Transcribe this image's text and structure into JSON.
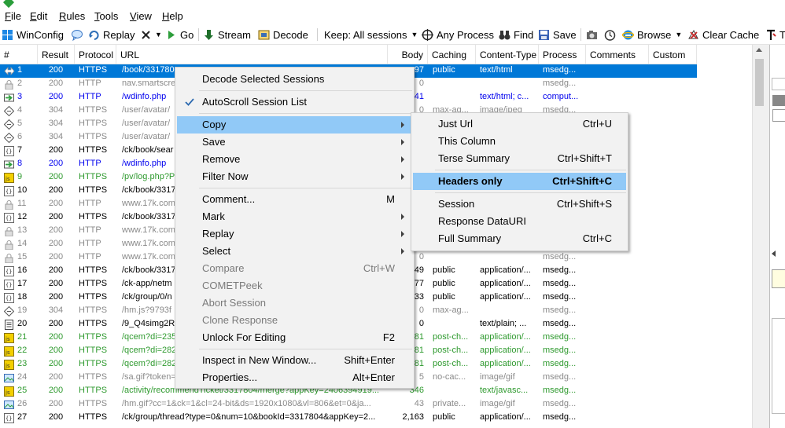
{
  "menubar": [
    "File",
    "Edit",
    "Rules",
    "Tools",
    "View",
    "Help"
  ],
  "toolbar": {
    "winconfig": "WinConfig",
    "replay": "Replay",
    "go": "Go",
    "stream": "Stream",
    "decode": "Decode",
    "keep": "Keep: All sessions",
    "any_process": "Any Process",
    "find": "Find",
    "save": "Save",
    "browse": "Browse",
    "clear_cache": "Clear Cache",
    "text_wizard": "T"
  },
  "columns": [
    "#",
    "Result",
    "Protocol",
    "URL",
    "Body",
    "Caching",
    "Content-Type",
    "Process",
    "Comments",
    "Custom"
  ],
  "rows": [
    {
      "id": "1",
      "result": "200",
      "protocol": "HTTPS",
      "url": "/book/331780",
      "body": "97",
      "caching": "public",
      "ctype": "text/html",
      "process": "msedg...",
      "style": "selected",
      "icon": "icon-arrows"
    },
    {
      "id": "2",
      "result": "200",
      "protocol": "HTTP",
      "url": "nav.smartscre",
      "body": "0",
      "caching": "",
      "ctype": "",
      "process": "msedg...",
      "style": "gray",
      "icon": "icon-lock"
    },
    {
      "id": "3",
      "result": "200",
      "protocol": "HTTP",
      "url": "/wdinfo.php",
      "body": "41",
      "caching": "",
      "ctype": "text/html; c...",
      "process": "comput...",
      "style": "blue",
      "icon": "icon-arrow-green"
    },
    {
      "id": "4",
      "result": "304",
      "protocol": "HTTPS",
      "url": "/user/avatar/",
      "body": "0",
      "caching": "max-ag...",
      "ctype": "image/jpeg",
      "process": "msedg...",
      "style": "gray",
      "icon": "icon-diamond"
    },
    {
      "id": "5",
      "result": "304",
      "protocol": "HTTPS",
      "url": "/user/avatar/",
      "body": "",
      "caching": "",
      "ctype": "",
      "process": "",
      "style": "gray",
      "icon": "icon-diamond"
    },
    {
      "id": "6",
      "result": "304",
      "protocol": "HTTPS",
      "url": "/user/avatar/",
      "body": "",
      "caching": "",
      "ctype": "",
      "process": "",
      "style": "gray",
      "icon": "icon-diamond"
    },
    {
      "id": "7",
      "result": "200",
      "protocol": "HTTPS",
      "url": "/ck/book/sear",
      "body": "",
      "caching": "",
      "ctype": "",
      "process": "",
      "style": "black",
      "icon": "icon-json"
    },
    {
      "id": "8",
      "result": "200",
      "protocol": "HTTP",
      "url": "/wdinfo.php",
      "body": "",
      "caching": "",
      "ctype": "",
      "process": "",
      "style": "blue",
      "icon": "icon-arrow-green"
    },
    {
      "id": "9",
      "result": "200",
      "protocol": "HTTPS",
      "url": "/pv/log.php?P",
      "body": "",
      "caching": "",
      "ctype": "",
      "process": "",
      "style": "green",
      "icon": "icon-js"
    },
    {
      "id": "10",
      "result": "200",
      "protocol": "HTTPS",
      "url": "/ck/book/3317",
      "body": "",
      "caching": "",
      "ctype": "",
      "process": "",
      "style": "black",
      "icon": "icon-json"
    },
    {
      "id": "11",
      "result": "200",
      "protocol": "HTTP",
      "url": "www.17k.com",
      "body": "",
      "caching": "",
      "ctype": "",
      "process": "",
      "style": "gray",
      "icon": "icon-lock"
    },
    {
      "id": "12",
      "result": "200",
      "protocol": "HTTPS",
      "url": "/ck/book/3317",
      "body": "",
      "caching": "",
      "ctype": "",
      "process": "",
      "style": "black",
      "icon": "icon-json"
    },
    {
      "id": "13",
      "result": "200",
      "protocol": "HTTP",
      "url": "www.17k.com",
      "body": "",
      "caching": "",
      "ctype": "",
      "process": "",
      "style": "gray",
      "icon": "icon-lock"
    },
    {
      "id": "14",
      "result": "200",
      "protocol": "HTTP",
      "url": "www.17k.com",
      "body": "",
      "caching": "",
      "ctype": "",
      "process": "",
      "style": "gray",
      "icon": "icon-lock"
    },
    {
      "id": "15",
      "result": "200",
      "protocol": "HTTP",
      "url": "www.17k.com",
      "body": "0",
      "caching": "",
      "ctype": "",
      "process": "msedg...",
      "style": "gray",
      "icon": "icon-lock"
    },
    {
      "id": "16",
      "result": "200",
      "protocol": "HTTPS",
      "url": "/ck/book/3317",
      "body": "49",
      "caching": "public",
      "ctype": "application/...",
      "process": "msedg...",
      "style": "black",
      "icon": "icon-json"
    },
    {
      "id": "17",
      "result": "200",
      "protocol": "HTTPS",
      "url": "/ck-app/netm",
      "body": "77",
      "caching": "public",
      "ctype": "application/...",
      "process": "msedg...",
      "style": "black",
      "icon": "icon-json"
    },
    {
      "id": "18",
      "result": "200",
      "protocol": "HTTPS",
      "url": "/ck/group/0/n",
      "body": "33",
      "caching": "public",
      "ctype": "application/...",
      "process": "msedg...",
      "style": "black",
      "icon": "icon-json"
    },
    {
      "id": "19",
      "result": "304",
      "protocol": "HTTPS",
      "url": "/hm.js?9793f",
      "body": "0",
      "caching": "max-ag...",
      "ctype": "",
      "process": "msedg...",
      "style": "gray",
      "icon": "icon-diamond"
    },
    {
      "id": "20",
      "result": "200",
      "protocol": "HTTPS",
      "url": "/9_Q4simg2R",
      "body": "0",
      "caching": "",
      "ctype": "text/plain; ...",
      "process": "msedg...",
      "style": "black",
      "icon": "icon-doc"
    },
    {
      "id": "21",
      "result": "200",
      "protocol": "HTTPS",
      "url": "/qcem?di=235",
      "body": "81",
      "caching": "post-ch...",
      "ctype": "application/...",
      "process": "msedg...",
      "style": "green",
      "icon": "icon-js"
    },
    {
      "id": "22",
      "result": "200",
      "protocol": "HTTPS",
      "url": "/qcem?di=282",
      "body": "81",
      "caching": "post-ch...",
      "ctype": "application/...",
      "process": "msedg...",
      "style": "green",
      "icon": "icon-js"
    },
    {
      "id": "23",
      "result": "200",
      "protocol": "HTTPS",
      "url": "/qcem?di=282",
      "body": "81",
      "caching": "post-ch...",
      "ctype": "application/...",
      "process": "msedg...",
      "style": "green",
      "icon": "icon-js"
    },
    {
      "id": "24",
      "result": "200",
      "protocol": "HTTPS",
      "url": "/sa.gif?token=",
      "body": "5",
      "caching": "no-cac...",
      "ctype": "image/gif",
      "process": "msedg...",
      "style": "gray",
      "icon": "icon-image"
    },
    {
      "id": "25",
      "result": "200",
      "protocol": "HTTPS",
      "url": "/activity/recommendTicket/3317804/merge?appKey=2406394919...",
      "body": "346",
      "caching": "",
      "ctype": "text/javasc...",
      "process": "msedg...",
      "style": "green",
      "icon": "icon-js"
    },
    {
      "id": "26",
      "result": "200",
      "protocol": "HTTPS",
      "url": "/hm.gif?cc=1&ck=1&cl=24-bit&ds=1920x1080&vl=806&et=0&ja...",
      "body": "43",
      "caching": "private...",
      "ctype": "image/gif",
      "process": "msedg...",
      "style": "gray",
      "icon": "icon-image"
    },
    {
      "id": "27",
      "result": "200",
      "protocol": "HTTPS",
      "url": "/ck/group/thread?type=0&num=10&bookId=3317804&appKey=2...",
      "body": "2,163",
      "caching": "public",
      "ctype": "application/...",
      "process": "msedg...",
      "style": "black",
      "icon": "icon-json"
    }
  ],
  "context_menu": {
    "decode": "Decode Selected Sessions",
    "autoscroll": "AutoScroll Session List",
    "copy": "Copy",
    "save": "Save",
    "remove": "Remove",
    "filter_now": "Filter Now",
    "comment": "Comment...",
    "comment_sc": "M",
    "mark": "Mark",
    "replay": "Replay",
    "select": "Select",
    "compare": "Compare",
    "compare_sc": "Ctrl+W",
    "cometpeek": "COMETPeek",
    "abort": "Abort Session",
    "clone": "Clone Response",
    "unlock": "Unlock For Editing",
    "unlock_sc": "F2",
    "inspect": "Inspect in New Window...",
    "inspect_sc": "Shift+Enter",
    "properties": "Properties...",
    "properties_sc": "Alt+Enter"
  },
  "copy_submenu": {
    "just_url": "Just Url",
    "just_url_sc": "Ctrl+U",
    "this_column": "This Column",
    "terse": "Terse Summary",
    "terse_sc": "Ctrl+Shift+T",
    "headers": "Headers only",
    "headers_sc": "Ctrl+Shift+C",
    "session": "Session",
    "session_sc": "Ctrl+Shift+S",
    "datauri": "Response DataURI",
    "full": "Full Summary",
    "full_sc": "Ctrl+C"
  },
  "colors": {
    "selection": "#0078d7",
    "menu_highlight": "#91c9f7",
    "text_blue": "#0000ee",
    "text_green": "#2f9a2f",
    "text_gray": "#8a8a8a"
  }
}
